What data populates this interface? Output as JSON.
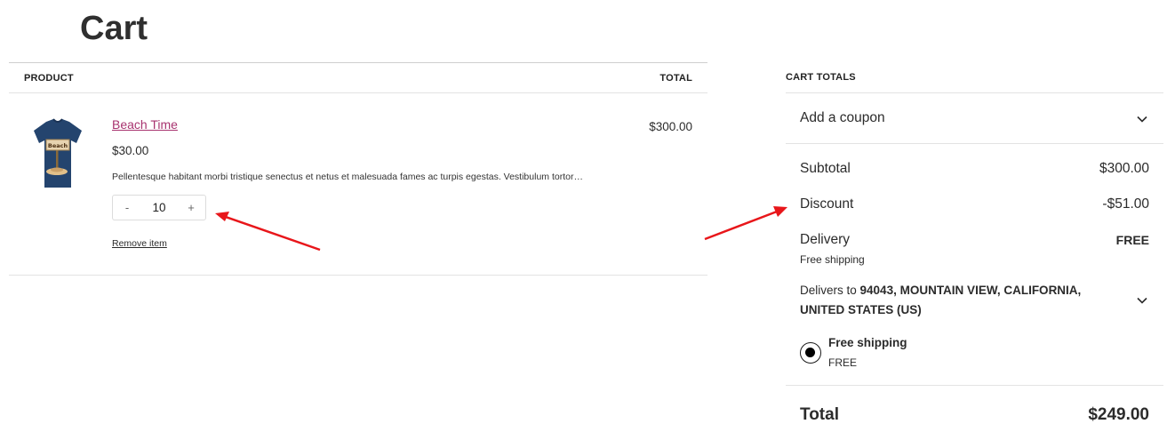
{
  "page": {
    "title": "Cart"
  },
  "table": {
    "header_product": "PRODUCT",
    "header_total": "TOTAL",
    "item": {
      "name": "Beach Time",
      "price": "$30.00",
      "description": "Pellentesque habitant morbi tristique senectus et netus et malesuada fames ac turpis egestas. Vestibulum tortor…",
      "quantity": "10",
      "minus": "-",
      "plus": "+",
      "remove": "Remove item",
      "line_total": "$300.00",
      "thumbnail_text": "Beach"
    }
  },
  "totals": {
    "title": "CART TOTALS",
    "coupon": "Add a coupon",
    "subtotal_label": "Subtotal",
    "subtotal_value": "$300.00",
    "discount_label": "Discount",
    "discount_value": "-$51.00",
    "delivery_label": "Delivery",
    "delivery_value": "FREE",
    "delivery_sub": "Free shipping",
    "delivers_to_prefix": "Delivers to ",
    "delivers_to_address": "94043, MOUNTAIN VIEW, CALIFORNIA, UNITED STATES (US)",
    "shipping_option_name": "Free shipping",
    "shipping_option_price": "FREE",
    "total_label": "Total",
    "total_value": "$249.00"
  },
  "colors": {
    "link": "#a8336f",
    "annotation_arrow": "#e8161a",
    "shirt": "#24446e"
  }
}
